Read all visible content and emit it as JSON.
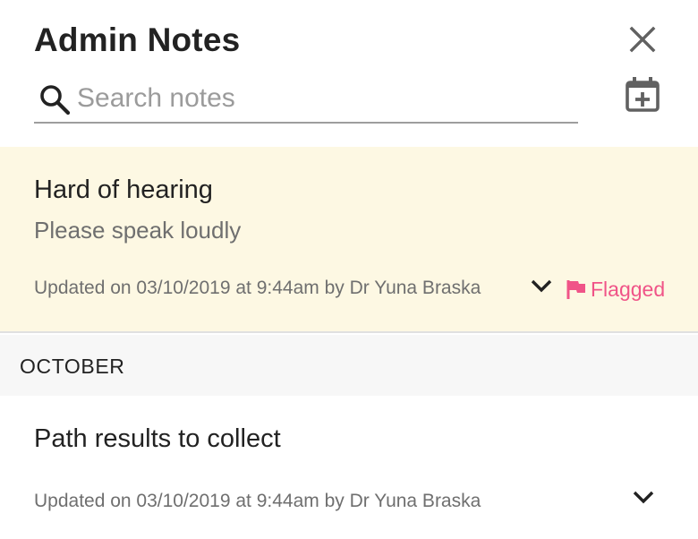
{
  "header": {
    "title": "Admin Notes"
  },
  "search": {
    "placeholder": "Search notes",
    "value": ""
  },
  "icons": {
    "close": "close-icon",
    "search": "search-icon",
    "add_date": "calendar-plus-icon",
    "expand": "chevron-down-icon",
    "flag": "flag-icon"
  },
  "colors": {
    "flagged_background": "#fdf8e3",
    "flag_accent": "#f05488",
    "section_background": "#f7f7f7"
  },
  "flagged_note": {
    "title": "Hard of hearing",
    "body": "Please speak loudly",
    "meta": "Updated on 03/10/2019 at 9:44am by Dr Yuna Braska",
    "flag_label": "Flagged"
  },
  "section": {
    "label": "OCTOBER"
  },
  "notes": [
    {
      "title": "Path results to collect",
      "meta": "Updated on 03/10/2019 at 9:44am by Dr Yuna Braska"
    }
  ]
}
